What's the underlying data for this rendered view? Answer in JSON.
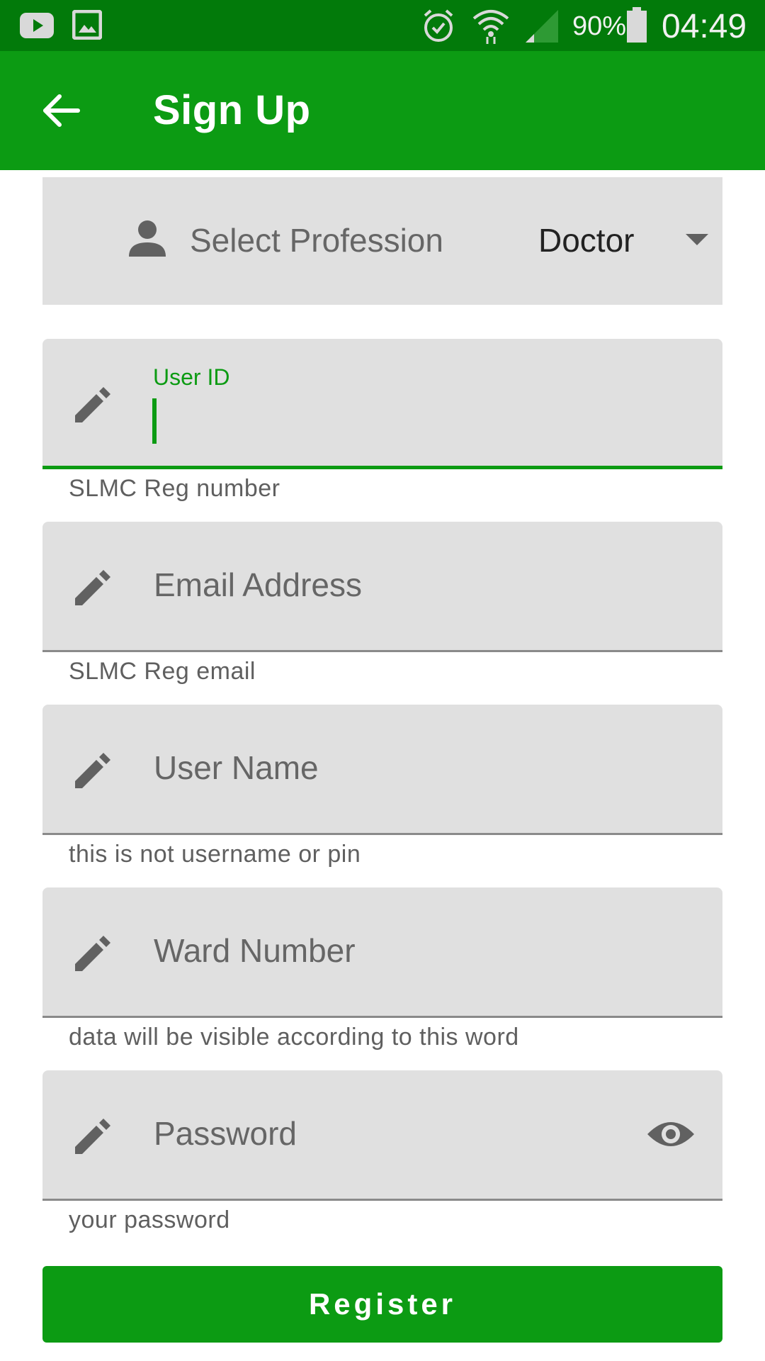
{
  "status_bar": {
    "battery_percent": "90%",
    "clock": "04:49",
    "icons": [
      "youtube-icon",
      "gallery-icon",
      "alarm-icon",
      "wifi-icon",
      "signal-icon",
      "battery-icon"
    ]
  },
  "app_bar": {
    "title": "Sign Up",
    "back_icon": "arrow-back-icon"
  },
  "profession": {
    "label": "Select Profession",
    "value": "Doctor",
    "icon": "person-icon"
  },
  "fields": {
    "user_id": {
      "label": "User ID",
      "value": "",
      "helper": "SLMC Reg number",
      "focused": true
    },
    "email": {
      "placeholder": "Email Address",
      "helper": "SLMC Reg email"
    },
    "user_name": {
      "placeholder": "User Name",
      "helper": "this is not username or pin"
    },
    "ward_number": {
      "placeholder": "Ward Number",
      "helper": "data will be visible according to this word"
    },
    "password": {
      "placeholder": "Password",
      "helper": "your password"
    }
  },
  "register": {
    "label": "Register"
  },
  "colors": {
    "status_bar": "#027a0a",
    "app_bar": "#0c9b13",
    "accent": "#0c9b13",
    "field_bg": "#e0e0e0"
  }
}
